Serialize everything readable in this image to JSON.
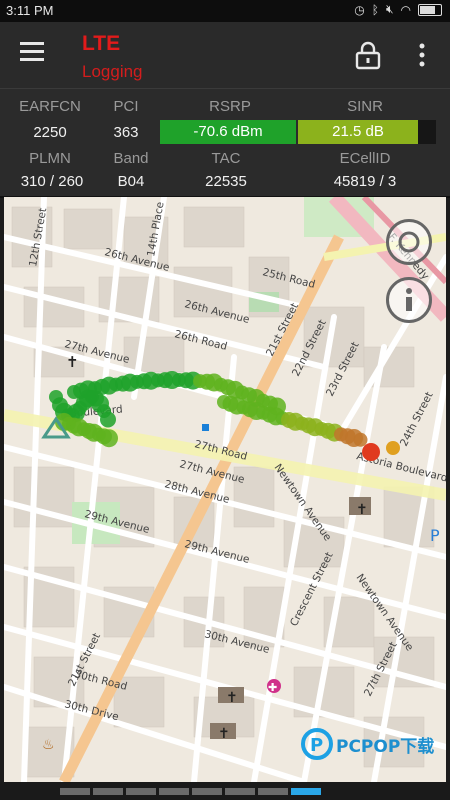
{
  "status_bar": {
    "time": "3:11 PM"
  },
  "app_bar": {
    "title": "LTE",
    "subtitle": "Logging",
    "colors": {
      "title": "#e21b1b",
      "background": "#2a2a2a"
    }
  },
  "cell_info": {
    "labels": {
      "earfcn": "EARFCN",
      "pci": "PCI",
      "rsrp": "RSRP",
      "sinr": "SINR",
      "plmn": "PLMN",
      "band": "Band",
      "tac": "TAC",
      "ecellid": "ECellID"
    },
    "values": {
      "earfcn": "2250",
      "pci": "363",
      "rsrp": "-70.6 dBm",
      "sinr": "21.5 dB",
      "plmn": "310 / 260",
      "band": "B04",
      "tac": "22535",
      "ecellid": "45819 / 3"
    },
    "rsrp_level": 1.0,
    "sinr_level": 0.87,
    "colors": {
      "rsrp": "#1fa22a",
      "sinr": "#8cb21c"
    }
  },
  "map": {
    "streets": [
      "26th Avenue",
      "26th Road",
      "27th Avenue",
      "27th Road",
      "28th Avenue",
      "29th Avenue",
      "30th Avenue",
      "30th Road",
      "30th Drive",
      "21st Street",
      "23rd Street",
      "24th Street",
      "27th Street",
      "12th Street",
      "14th Place",
      "22nd Street",
      "25th Road",
      "Newtown Avenue",
      "Crescent Street",
      "Astoria Boulevard",
      "Boulevard",
      "F. Kennedy"
    ],
    "track_colors": [
      "#1fa22a",
      "#5fb31f",
      "#8cb21c",
      "#c0762a",
      "#e03a1f"
    ]
  },
  "footer": {
    "segments": 8,
    "active_segment": 7
  },
  "watermark": {
    "text": "PCPOP下载",
    "accent": "#1da1e4"
  }
}
